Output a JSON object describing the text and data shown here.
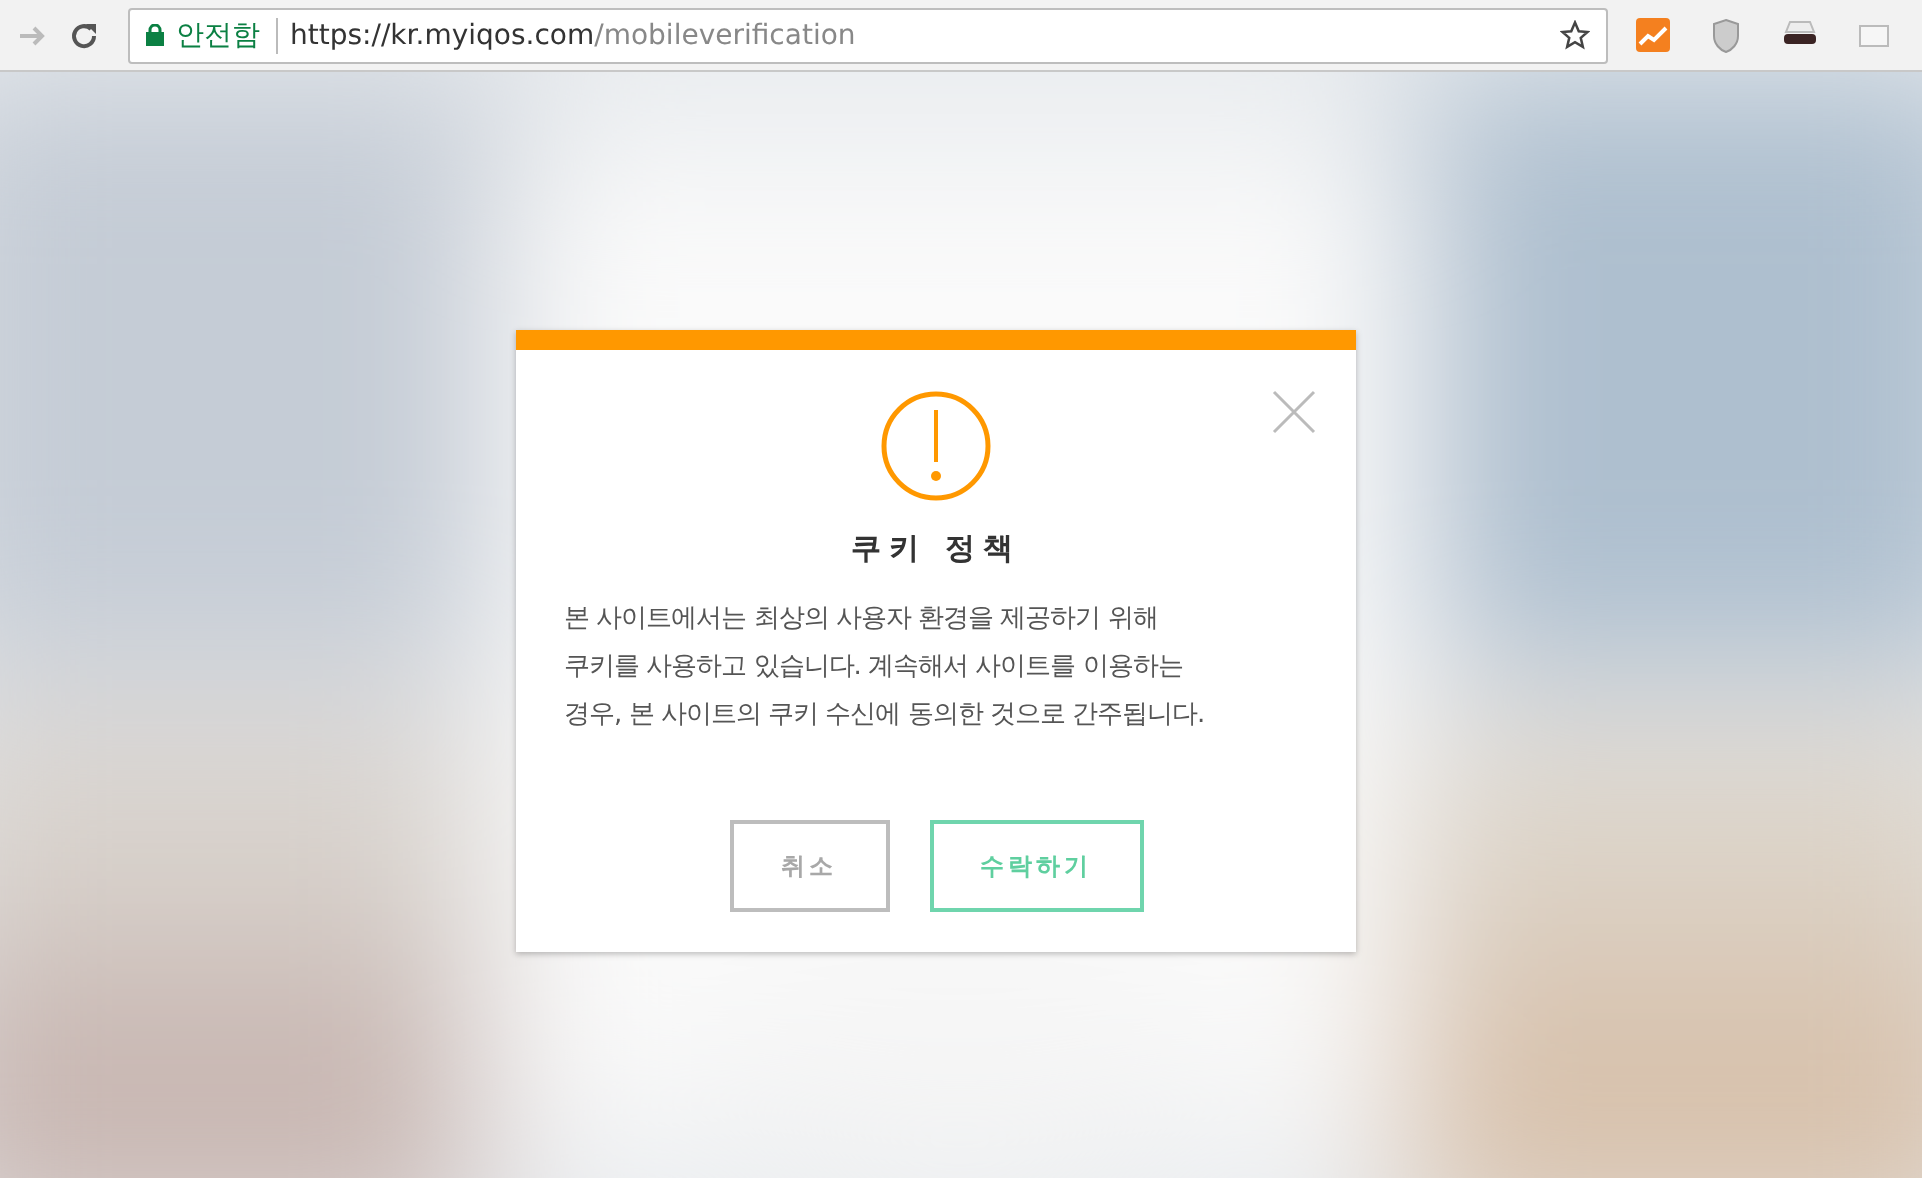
{
  "browser": {
    "security_label": "안전함",
    "url_host": "https://kr.myiqos.com",
    "url_path": "/mobileverification"
  },
  "dialog": {
    "title": "쿠키 정책",
    "message": "본 사이트에서는 최상의 사용자 환경을 제공하기 위해\n쿠키를 사용하고 있습니다. 계속해서 사이트를 이용하는\n경우, 본 사이트의 쿠키 수신에 동의한 것으로 간주됩니다.",
    "buttons": [
      {
        "label": "취소",
        "kind": "secondary"
      },
      {
        "label": "수락하기",
        "kind": "primary"
      }
    ]
  }
}
